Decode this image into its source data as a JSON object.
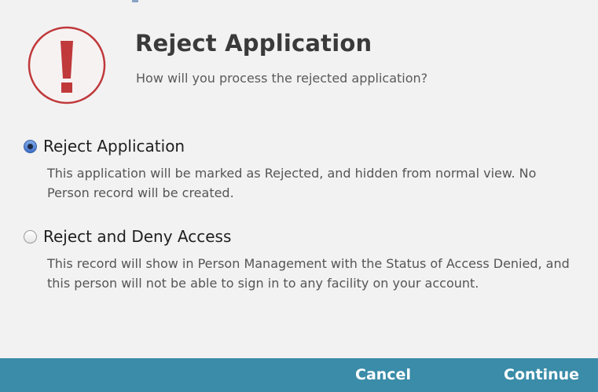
{
  "dialog": {
    "title": "Reject Application",
    "subtitle": "How will you process the rejected application?",
    "icon": "exclamation-warning-icon",
    "accent_color": "#c0393b"
  },
  "options": [
    {
      "label": "Reject Application",
      "description": "This application will be marked as Rejected, and hidden from normal view. No Person record will be created.",
      "selected": true
    },
    {
      "label": "Reject and Deny Access",
      "description": "This record will show in Person Management with the Status of Access Denied, and this person will not be able to sign in to any facility on your account.",
      "selected": false
    }
  ],
  "footer": {
    "cancel_label": "Cancel",
    "continue_label": "Continue",
    "background_color": "#3a8ca8"
  }
}
